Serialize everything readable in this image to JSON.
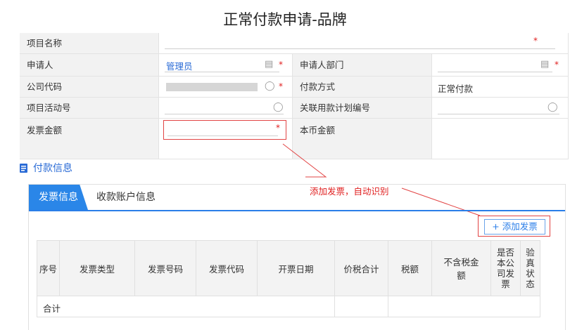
{
  "page_title": "正常付款申请-品牌",
  "form": {
    "project_name_label": "项目名称",
    "applicant_label": "申请人",
    "applicant_value": "管理员",
    "applicant_dept_label": "申请人部门",
    "company_code_label": "公司代码",
    "payment_method_label": "付款方式",
    "payment_method_value": "正常付款",
    "activity_no_label": "项目活动号",
    "related_plan_label": "关联用款计划编号",
    "invoice_amount_label": "发票金额",
    "local_amount_label": "本币金额",
    "required_mark": "*"
  },
  "section": {
    "title": "付款信息"
  },
  "tabs": {
    "active": "发票信息",
    "second": "收款账户信息"
  },
  "annotation": "添加发票，自动识别",
  "add_invoice_label": "+ 添加发票",
  "table": {
    "headers": [
      "序号",
      "发票类型",
      "发票号码",
      "发票代码",
      "开票日期",
      "价税合计",
      "税额",
      "不含税金额",
      "是否本公司发票",
      "验真状态"
    ],
    "total_label": "合计"
  },
  "colors": {
    "accent": "#2a86e8",
    "required": "#e02020",
    "annotation": "#e02020"
  }
}
